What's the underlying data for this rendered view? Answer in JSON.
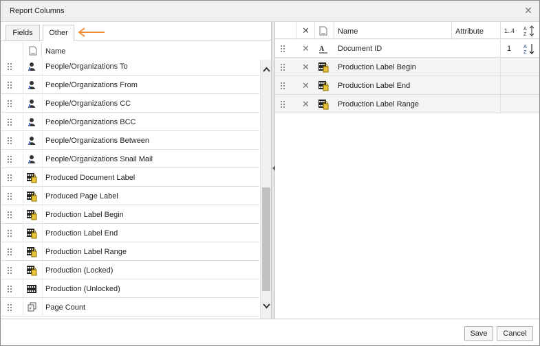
{
  "dialog": {
    "title": "Report Columns"
  },
  "tabs": {
    "fields": "Fields",
    "other": "Other"
  },
  "left": {
    "header": {
      "name": "Name"
    },
    "rows": [
      {
        "label": "People/Organizations To",
        "icon": "person-icon"
      },
      {
        "label": "People/Organizations From",
        "icon": "person-icon"
      },
      {
        "label": "People/Organizations CC",
        "icon": "person-icon"
      },
      {
        "label": "People/Organizations BCC",
        "icon": "person-icon"
      },
      {
        "label": "People/Organizations Between",
        "icon": "person-icon"
      },
      {
        "label": "People/Organizations Snail Mail",
        "icon": "person-icon"
      },
      {
        "label": "Produced Document Label",
        "icon": "production-locked-icon"
      },
      {
        "label": "Produced Page Label",
        "icon": "production-locked-icon"
      },
      {
        "label": "Production Label Begin",
        "icon": "production-locked-icon"
      },
      {
        "label": "Production Label End",
        "icon": "production-locked-icon"
      },
      {
        "label": "Production Label Range",
        "icon": "production-locked-icon"
      },
      {
        "label": "Production (Locked)",
        "icon": "production-locked-icon"
      },
      {
        "label": "Production (Unlocked)",
        "icon": "production-icon"
      },
      {
        "label": "Page Count",
        "icon": "page-count-icon"
      }
    ]
  },
  "right": {
    "header": {
      "name": "Name",
      "attribute": "Attribute",
      "order_label": "1..4"
    },
    "rows": [
      {
        "label": "Document ID",
        "icon": "text-field-icon",
        "order": "1"
      },
      {
        "label": "Production Label Begin",
        "icon": "production-locked-icon",
        "order": ""
      },
      {
        "label": "Production Label End",
        "icon": "production-locked-icon",
        "order": ""
      },
      {
        "label": "Production Label Range",
        "icon": "production-locked-icon",
        "order": ""
      }
    ]
  },
  "footer": {
    "save": "Save",
    "cancel": "Cancel"
  },
  "colors": {
    "arrow": "#f28c38",
    "accent": "#1a3e8c"
  }
}
